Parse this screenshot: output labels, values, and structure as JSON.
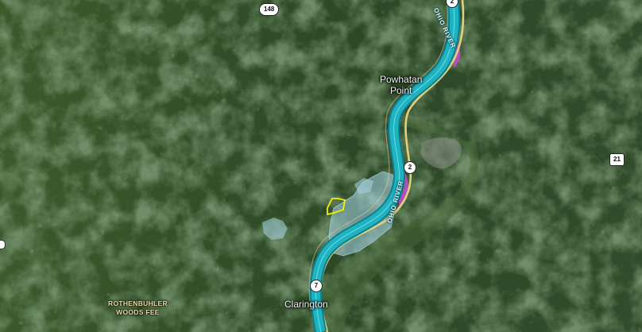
{
  "map": {
    "places": {
      "powhatan_point": "Powhatan\nPoint",
      "clarington": "Clarington",
      "woods_fee": "ROTHENBUHLER\nWOODS FEE"
    },
    "river": {
      "name": "OHIO RIVER"
    },
    "routes": {
      "sr148": "148",
      "wv2_top": "2",
      "wv2_mid": "2",
      "sr7": "7",
      "route21": "21"
    },
    "colors": {
      "terrain": "#2f4a27",
      "river": "#1fb3c1",
      "river_edge": "#7ee9f0",
      "road_wv": "#e4cf7a",
      "highlight_zone": "#c24fc9",
      "lease_area": "#a9d7ea",
      "property_outline": "#f4f000"
    }
  }
}
